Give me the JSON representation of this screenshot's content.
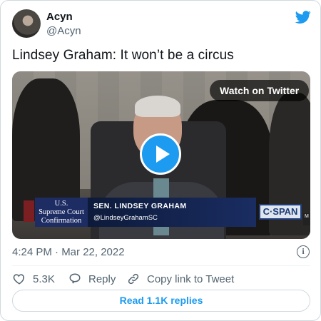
{
  "author": {
    "name": "Acyn",
    "handle": "@Acyn"
  },
  "tweet": {
    "text": "Lindsey Graham: It won’t be a circus",
    "timestamp": "4:24 PM · Mar 22, 2022"
  },
  "video": {
    "watch_label": "Watch on Twitter",
    "lower_third": {
      "left_box": [
        "U.S.",
        "Supreme Court",
        "Confirmation"
      ],
      "name": "SEN. LINDSEY GRAHAM",
      "handle": "@LindseyGrahamSC",
      "network": "C·SPAN",
      "corner_tag": "M"
    }
  },
  "actions": {
    "likes": "5.3K",
    "reply_label": "Reply",
    "copy_label": "Copy link to Tweet"
  },
  "read_replies_label": "Read 1.1K replies",
  "colors": {
    "accent": "#1d9bf0",
    "muted": "#536471",
    "text": "#0f1419"
  },
  "icons": [
    "twitter-bird-icon",
    "play-icon",
    "info-icon",
    "heart-icon",
    "reply-bubble-icon",
    "link-icon"
  ]
}
